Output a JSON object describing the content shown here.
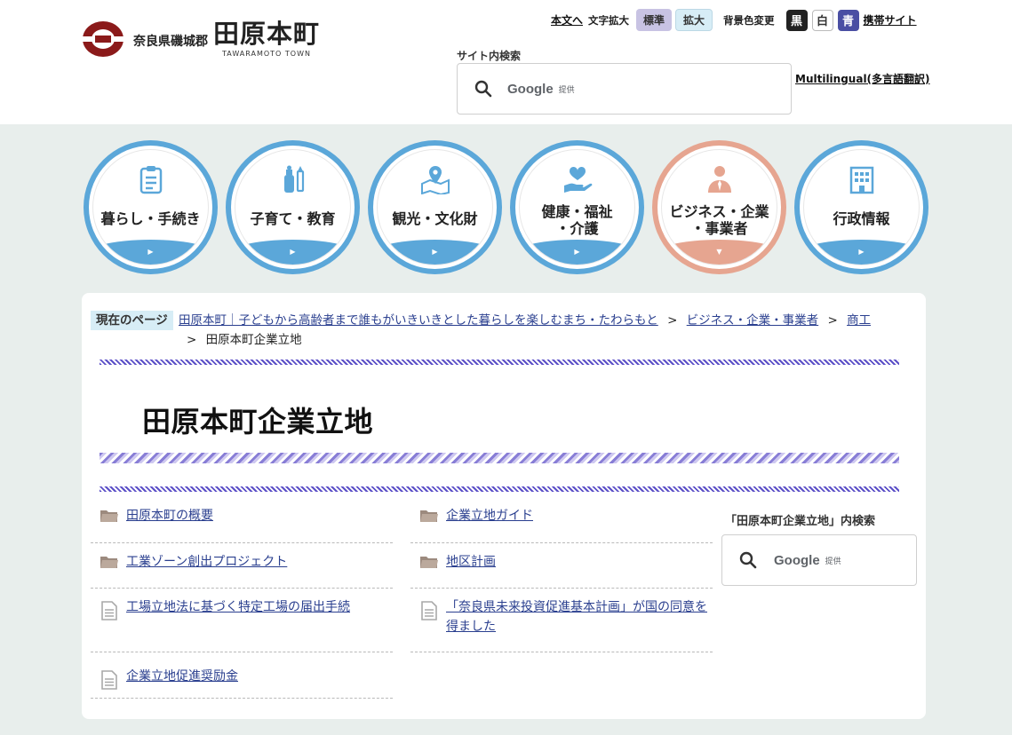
{
  "header": {
    "logo_pref": "奈良県磯城郡",
    "logo_town": "田原本町",
    "logo_en": "TAWARAMOTO TOWN",
    "skip_link": "本文へ",
    "font_size_label": "文字拡大",
    "font_std": "標準",
    "font_big": "拡大",
    "bg_label": "背景色変更",
    "bg_black": "黒",
    "bg_white": "白",
    "bg_blue": "青",
    "mobile_link": "携帯サイト",
    "search_label": "サイト内検索",
    "search_google": "Google",
    "search_google_sub": "提供",
    "multilingual": "Multilingual(多言語翻訳)"
  },
  "nav": {
    "items": [
      {
        "label": "暮らし・手続き",
        "icon": "clipboard-icon"
      },
      {
        "label": "子育て・教育",
        "icon": "baby-bottle-icon"
      },
      {
        "label": "観光・文化財",
        "icon": "map-pin-icon"
      },
      {
        "label": "健康・福祉\n・介護",
        "icon": "heart-hand-icon"
      },
      {
        "label": "ビジネス・企業\n・事業者",
        "icon": "businessperson-icon"
      },
      {
        "label": "行政情報",
        "icon": "building-icon"
      }
    ],
    "arrow": "▶",
    "active_arrow": "▼"
  },
  "breadcrumb": {
    "label": "現在のページ",
    "home": "田原本町｜子どもから高齢者まで誰もがいきいきとした暮らしを楽しむまち・たわらもと",
    "level1": "ビジネス・企業・事業者",
    "level2": "商工",
    "current": "田原本町企業立地",
    "sep": ">"
  },
  "main": {
    "title": "田原本町企業立地",
    "links": [
      {
        "label": "田原本町の概要",
        "type": "folder"
      },
      {
        "label": "企業立地ガイド",
        "type": "folder"
      },
      {
        "label": "工業ゾーン創出プロジェクト",
        "type": "folder"
      },
      {
        "label": "地区計画",
        "type": "folder"
      },
      {
        "label": "工場立地法に基づく特定工場の届出手続",
        "type": "document"
      },
      {
        "label": "「奈良県未来投資促進基本計画」が国の同意を得ました",
        "type": "document"
      },
      {
        "label": "企業立地促進奨励金",
        "type": "document"
      }
    ]
  },
  "side": {
    "search_label": "「田原本町企業立地」内検索",
    "search_google": "Google",
    "search_google_sub": "提供"
  },
  "colors": {
    "nav_blue": "#5ba7d9",
    "nav_active": "#e6a590",
    "link": "#2a3f8f",
    "stripe": "#5b4fc7",
    "logo_red": "#8b1a1a"
  }
}
